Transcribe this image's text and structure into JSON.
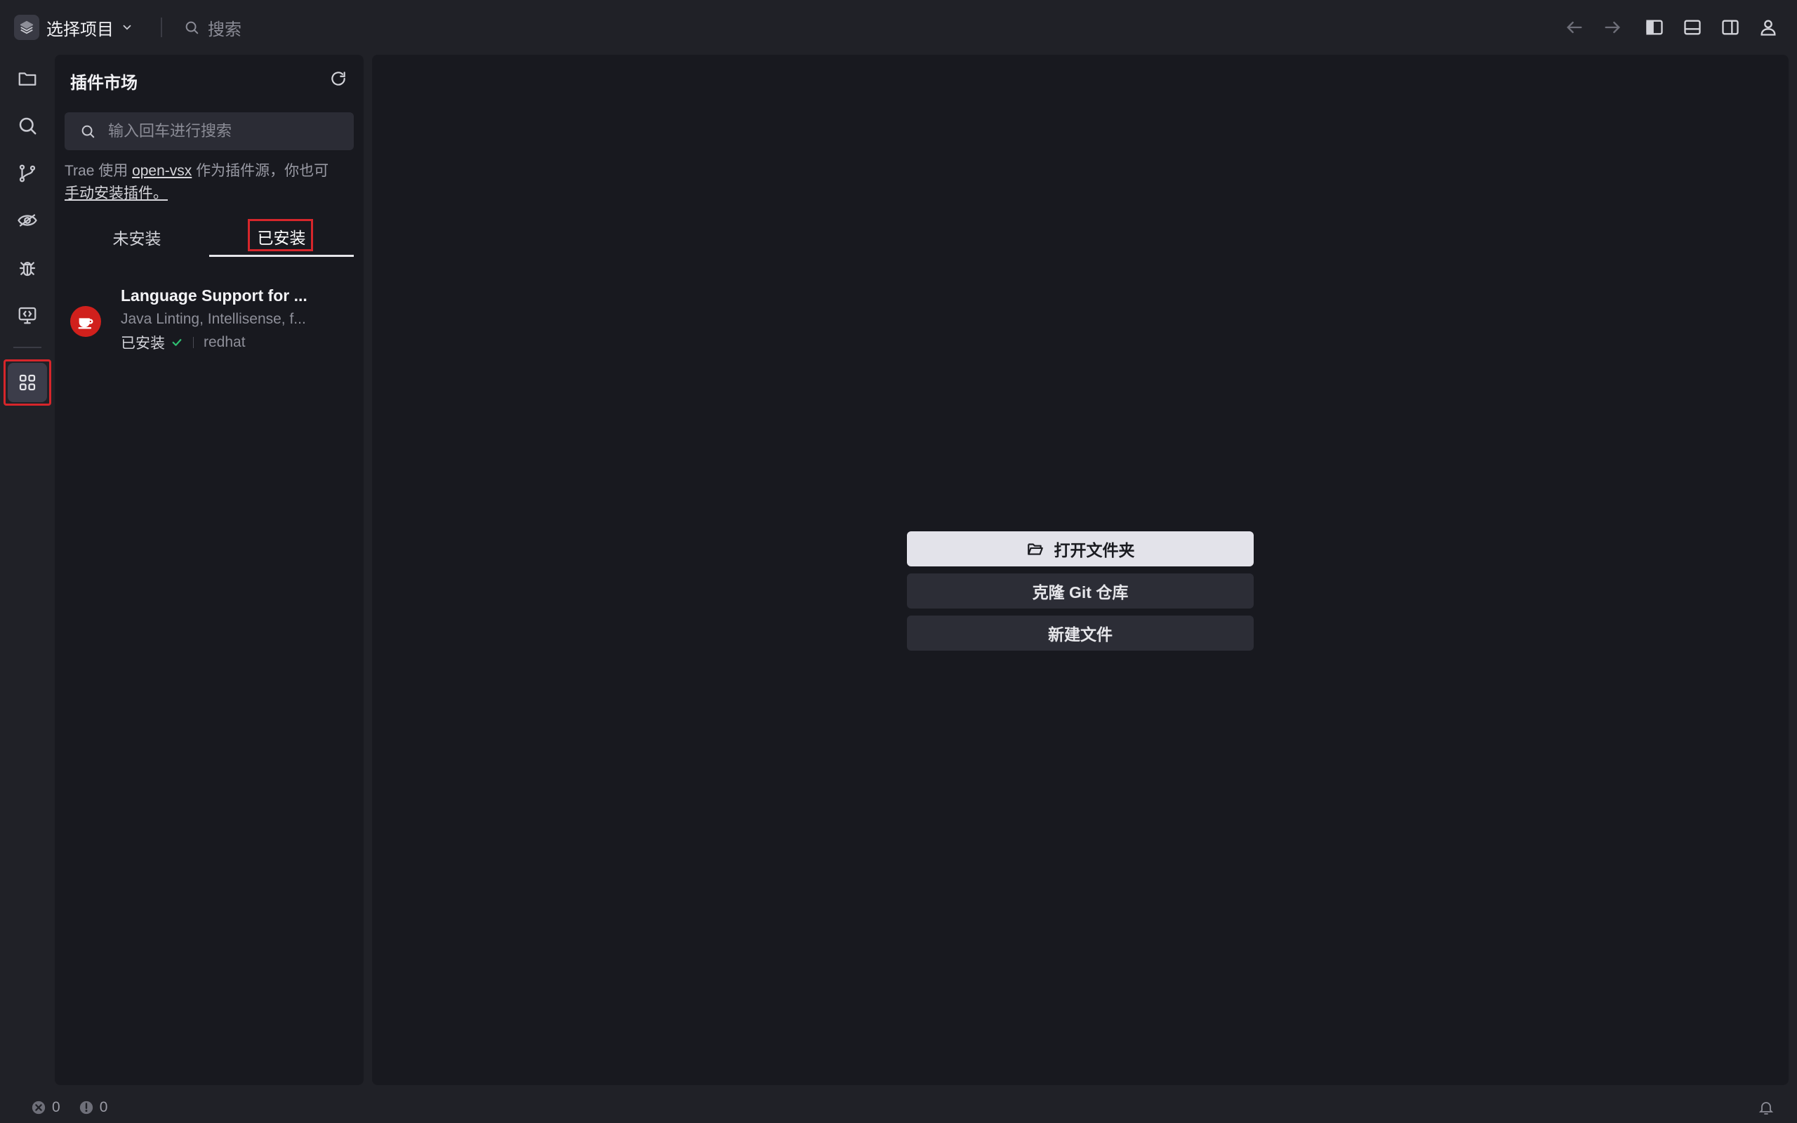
{
  "topbar": {
    "project_label": "选择项目",
    "search_placeholder": "搜索"
  },
  "sidebar": {
    "title": "插件市场",
    "search_placeholder": "输入回车进行搜索",
    "info_prefix": "Trae 使用 ",
    "info_link": "open-vsx",
    "info_middle": " 作为插件源，你也可",
    "info_link2": "手动安装插件。",
    "tabs": [
      {
        "label": "未安装",
        "active": false
      },
      {
        "label": "已安装",
        "active": true
      }
    ],
    "extensions": [
      {
        "name": "Language Support for ...",
        "description": "Java Linting, Intellisense, f...",
        "status": "已安装",
        "publisher": "redhat",
        "icon": "coffee-cup-icon",
        "icon_color": "#d0201c"
      }
    ]
  },
  "editor": {
    "actions": [
      {
        "label": "打开文件夹",
        "icon": "folder-open-icon"
      },
      {
        "label": "克隆 Git 仓库"
      },
      {
        "label": "新建文件"
      }
    ]
  },
  "statusbar": {
    "errors": "0",
    "warnings": "0"
  },
  "colors": {
    "highlight": "#d6262b",
    "primary_button": "#e3e3ea",
    "installed_check": "#2fbf71"
  }
}
